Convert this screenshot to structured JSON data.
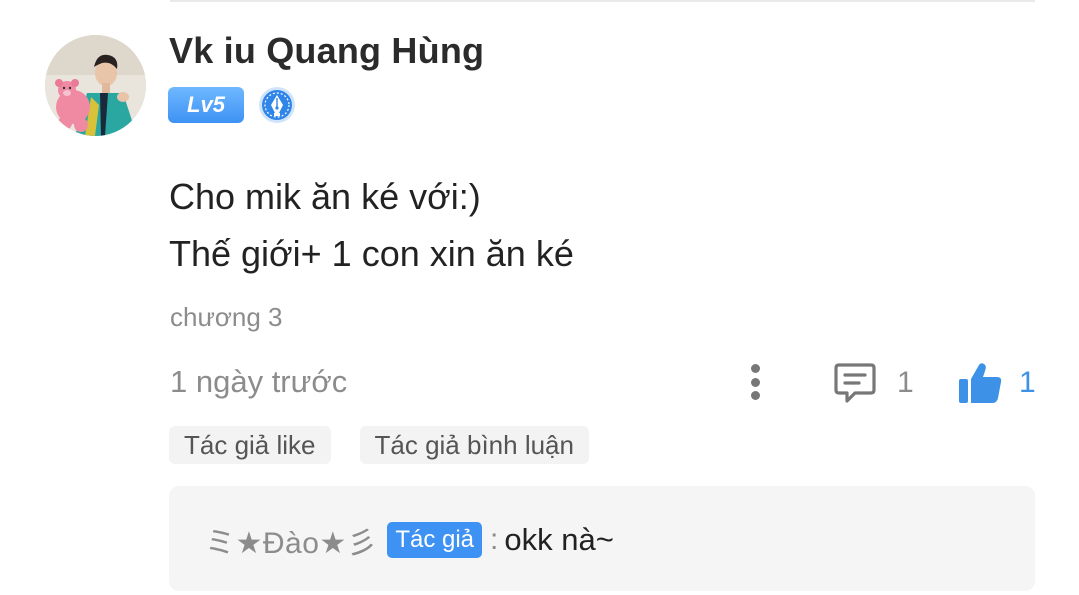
{
  "comment": {
    "username": "Vk iu Quang Hùng",
    "level": "Lv5",
    "badge_icon": "fountain-pen-badge-icon",
    "text_lines": [
      "Cho mik ăn ké với:)",
      "Thế giới+ 1 con xin ăn ké"
    ],
    "chapter": "chương 3",
    "time": "1 ngày trước",
    "reply_count": "1",
    "like_count": "1",
    "tags": [
      "Tác giả like",
      "Tác giả bình luận"
    ]
  },
  "reply": {
    "author": "ミ★Đào★彡",
    "author_badge": "Tác giả",
    "separator": ":",
    "text": "okk nà~"
  },
  "colors": {
    "accent": "#3e92f4",
    "muted_text": "#8c8c8c",
    "reply_bg": "#f5f5f5"
  }
}
